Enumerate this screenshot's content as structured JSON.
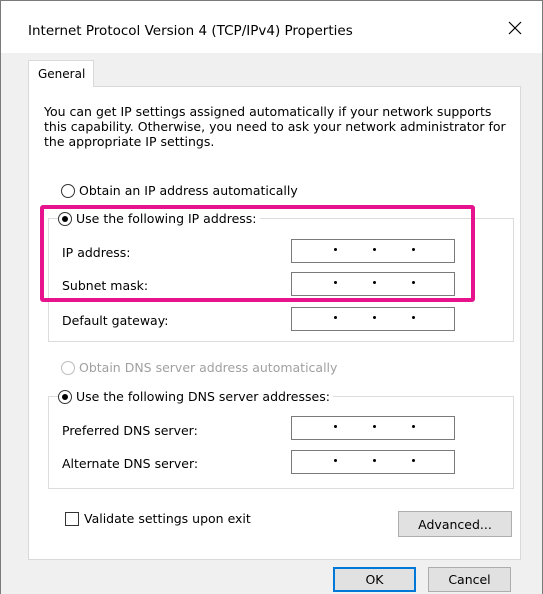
{
  "window": {
    "title": "Internet Protocol Version 4 (TCP/IPv4) Properties",
    "close_icon": "close-icon"
  },
  "tabs": [
    {
      "label": "General",
      "selected": true
    }
  ],
  "general": {
    "intro": "You can get IP settings assigned automatically if your network supports this capability. Otherwise, you need to ask your network administrator for the appropriate IP settings.",
    "ip": {
      "auto_label": "Obtain an IP address automatically",
      "manual_label": "Use the following IP address:",
      "selected": "manual",
      "fields": [
        {
          "label": "IP address:",
          "value": ". . ."
        },
        {
          "label": "Subnet mask:",
          "value": ". . ."
        },
        {
          "label": "Default gateway:",
          "value": ". . ."
        }
      ]
    },
    "dns": {
      "auto_label": "Obtain DNS server address automatically",
      "auto_disabled": true,
      "manual_label": "Use the following DNS server addresses:",
      "selected": "manual",
      "fields": [
        {
          "label": "Preferred DNS server:",
          "value": ". . ."
        },
        {
          "label": "Alternate DNS server:",
          "value": ". . ."
        }
      ]
    },
    "validate_label": "Validate settings upon exit",
    "validate_checked": false,
    "advanced_label": "Advanced..."
  },
  "buttons": {
    "ok_label": "OK",
    "cancel_label": "Cancel"
  },
  "colors": {
    "highlight": "#e6138c",
    "default_button_border": "#0078d7"
  }
}
